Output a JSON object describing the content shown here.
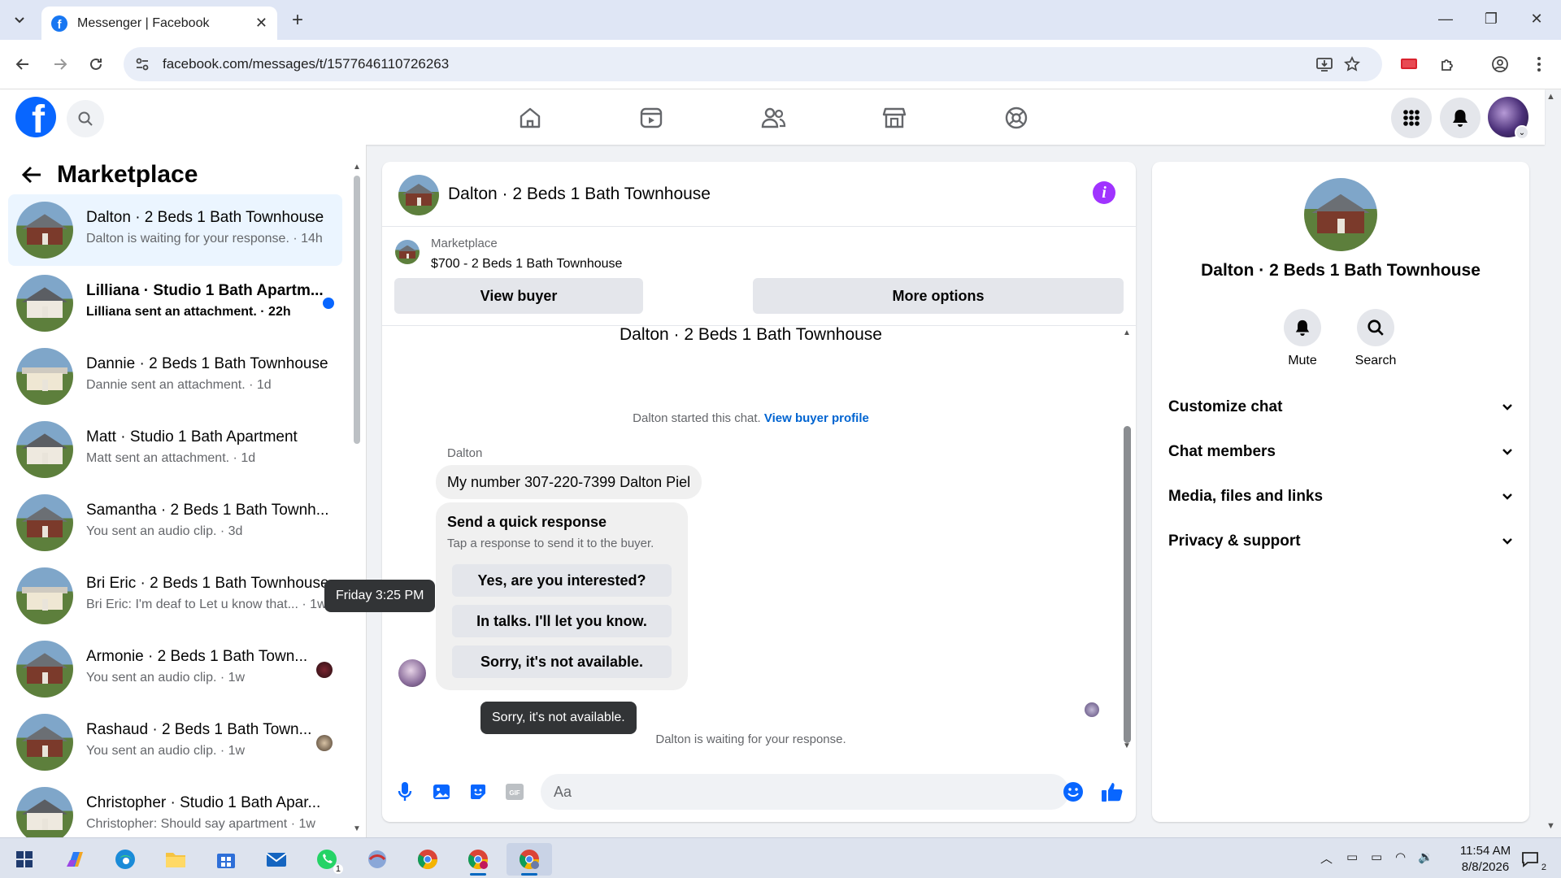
{
  "browser": {
    "tab_title": "Messenger | Facebook",
    "url": "facebook.com/messages/t/1577646110726263"
  },
  "sidebar": {
    "title": "Marketplace",
    "conversations": [
      {
        "name": "Dalton · 2 Beds 1 Bath Townhouse",
        "preview": "Dalton is waiting for your response. · 14h",
        "active": true
      },
      {
        "name": "Lilliana · Studio 1 Bath Apartm...",
        "preview": "Lilliana sent an attachment. · 22h",
        "unread": true
      },
      {
        "name": "Dannie · 2 Beds 1 Bath Townhouse",
        "preview": "Dannie sent an attachment. · 1d"
      },
      {
        "name": "Matt · Studio 1 Bath Apartment",
        "preview": "Matt sent an attachment. · 1d"
      },
      {
        "name": "Samantha · 2 Beds 1 Bath Townh...",
        "preview": "You sent an audio clip. · 3d"
      },
      {
        "name": "Bri Eric · 2 Beds 1 Bath Townhouse",
        "preview": "Bri Eric: I'm deaf to Let u know that... · 1w"
      },
      {
        "name": "Armonie · 2 Beds 1 Bath Town...",
        "preview": "You sent an audio clip. · 1w"
      },
      {
        "name": "Rashaud · 2 Beds 1 Bath Town...",
        "preview": "You sent an audio clip. · 1w"
      },
      {
        "name": "Christopher · Studio 1 Bath Apar...",
        "preview": "Christopher: Should say apartment · 1w"
      }
    ]
  },
  "chat": {
    "header_title": "Dalton · 2 Beds 1 Bath Townhouse",
    "listing_label": "Marketplace",
    "listing_price": "$700 - 2 Beds 1 Bath Townhouse",
    "view_buyer": "View buyer",
    "more_options": "More options",
    "thread_title": "Dalton · 2 Beds 1 Bath Townhouse",
    "started_text": "Dalton started this chat.",
    "view_buyer_profile": "View buyer profile",
    "sender_name": "Dalton",
    "message": "My number 307-220-7399 Dalton Piel",
    "quick_response_title": "Send a quick response",
    "quick_response_sub": "Tap a response to send it to the buyer.",
    "quick_responses": [
      "Yes, are you interested?",
      "In talks. I'll let you know.",
      "Sorry, it's not available."
    ],
    "tooltip_time": "Friday 3:25 PM",
    "tooltip_option": "Sorry, it's not available.",
    "waiting_text": "Dalton is waiting for your response.",
    "composer_placeholder": "Aa"
  },
  "info_panel": {
    "name": "Dalton · 2 Beds 1 Bath Townhouse",
    "mute": "Mute",
    "search": "Search",
    "sections": [
      "Customize chat",
      "Chat members",
      "Media, files and links",
      "Privacy & support"
    ]
  },
  "taskbar": {
    "time": "11:54 AM",
    "date": "8/8/2026",
    "whatsapp_badge": "1",
    "notification_badge": "2"
  },
  "colors": {
    "facebook_blue": "#0866ff",
    "messenger_purple": "#a033ff",
    "unread_dot": "#0866ff"
  }
}
